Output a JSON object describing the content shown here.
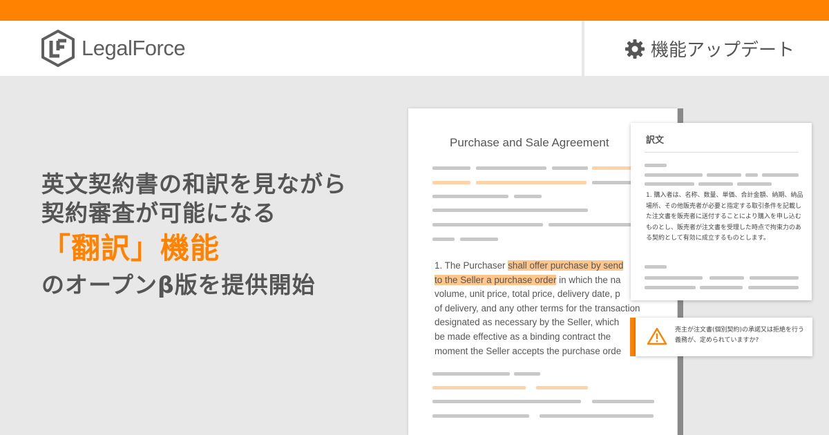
{
  "brand": {
    "name": "LegalForce",
    "accent_color": "#ff8200",
    "logo_icon": "legalforce-logo-icon"
  },
  "header": {
    "badge_icon": "gear-icon",
    "badge_label": "機能アップデート"
  },
  "headline": {
    "line1": "英文契約書の和訳を見ながら",
    "line2": "契約審査が可能になる",
    "line3": "「翻訳」機能",
    "line4": "のオープンβ版を提供開始"
  },
  "document": {
    "title": "Purchase and Sale Agreement",
    "clause_lines": [
      {
        "before": "1. The Purchaser ",
        "highlight": "shall offer purchase by send",
        "after": ""
      },
      {
        "before": "",
        "highlight": "to the Seller a purchase order",
        "after": " in which the na"
      },
      {
        "before": "volume, unit price, total price, delivery date, p",
        "highlight": "",
        "after": ""
      },
      {
        "before": "of delivery, and any other terms for the transaction",
        "highlight": "",
        "after": ""
      },
      {
        "before": "designated as necessary by the Seller, which",
        "highlight": "",
        "after": ""
      },
      {
        "before": "be made effective as a binding contract the",
        "highlight": "",
        "after": ""
      },
      {
        "before": "moment the Seller accepts the purchase orde",
        "highlight": "",
        "after": ""
      }
    ]
  },
  "translation": {
    "title": "訳文",
    "body": "1. 購入者は、名称、数量、単価、合計金額、納期、納品場所、その他販売者が必要と指定する取引条件を記載した注文書を販売者に送付することにより購入を申し込むものとし、販売者が注文書を受理した時点で拘束力のある契約として有効に成立するものとします。"
  },
  "alert": {
    "icon": "warning-icon",
    "text": "売主が注文書(個別契約)の承諾又は拒絶を行う義務が、定められていますか?"
  }
}
